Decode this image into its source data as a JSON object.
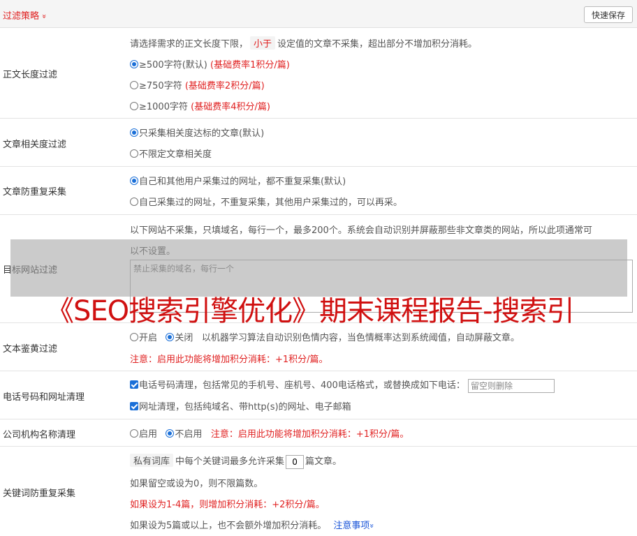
{
  "header": {
    "title": "过滤策略",
    "chevron": "»",
    "save_label": "快速保存"
  },
  "text_length": {
    "label": "正文长度过滤",
    "desc_before": "请选择需求的正文长度下限，",
    "desc_pill": "小于",
    "desc_after": "设定值的文章不采集，超出部分不增加积分消耗。",
    "options": [
      {
        "label": "≥500字符(默认)",
        "note": "(基础费率1积分/篇)",
        "selected": true
      },
      {
        "label": "≥750字符",
        "note": "(基础费率2积分/篇)",
        "selected": false
      },
      {
        "label": "≥1000字符",
        "note": "(基础费率4积分/篇)",
        "selected": false
      }
    ]
  },
  "relevance": {
    "label": "文章相关度过滤",
    "options": [
      {
        "label": "只采集相关度达标的文章(默认)",
        "selected": true
      },
      {
        "label": "不限定文章相关度",
        "selected": false
      }
    ]
  },
  "dedup": {
    "label": "文章防重复采集",
    "options": [
      {
        "label": "自己和其他用户采集过的网址，都不重复采集(默认)",
        "selected": true
      },
      {
        "label": "自己采集过的网址，不重复采集，其他用户采集过的，可以再采。",
        "selected": false
      }
    ]
  },
  "site_filter": {
    "label": "目标网站过滤",
    "desc1": "以下网站不采集，只填域名，每行一个，最多200个。系统会自动识别并屏蔽那些非文章类的网站，所以此项通常可",
    "desc2": "以不设置。",
    "placeholder": "禁止采集的域名，每行一个"
  },
  "porn": {
    "label": "文本鉴黄过滤",
    "on_label": "开启",
    "off_label": "关闭",
    "selected": "off",
    "desc": "以机器学习算法自动识别色情内容，当色情概率达到系统阈值，自动屏蔽文章。",
    "note": "注意：启用此功能将增加积分消耗：+1积分/篇。"
  },
  "phone_url": {
    "label": "电话号码和网址清理",
    "phone_text": "电话号码清理，包括常见的手机号、座机号、400电话格式，或替换成如下电话：",
    "phone_placeholder": "留空则删除",
    "url_text": "网址清理，包括纯域名、带http(s)的网址、电子邮箱"
  },
  "org": {
    "label": "公司机构名称清理",
    "on_label": "启用",
    "off_label": "不启用",
    "selected": "off",
    "note": "注意：启用此功能将增加积分消耗：+1积分/篇。"
  },
  "keyword": {
    "label": "关键词防重复采集",
    "pill": "私有词库",
    "text_before": "中每个关键词最多允许采集",
    "value": "0",
    "text_after": "篇文章。",
    "line2": "如果留空或设为0，则不限篇数。",
    "line3": "如果设为1-4篇，则增加积分消耗：+2积分/篇。",
    "line4": "如果设为5篇或以上，也不会额外增加积分消耗。",
    "link": "注意事项",
    "link_chev": "»"
  },
  "watermark": "《SEO搜索引擎优化》期末课程报告-搜索引"
}
